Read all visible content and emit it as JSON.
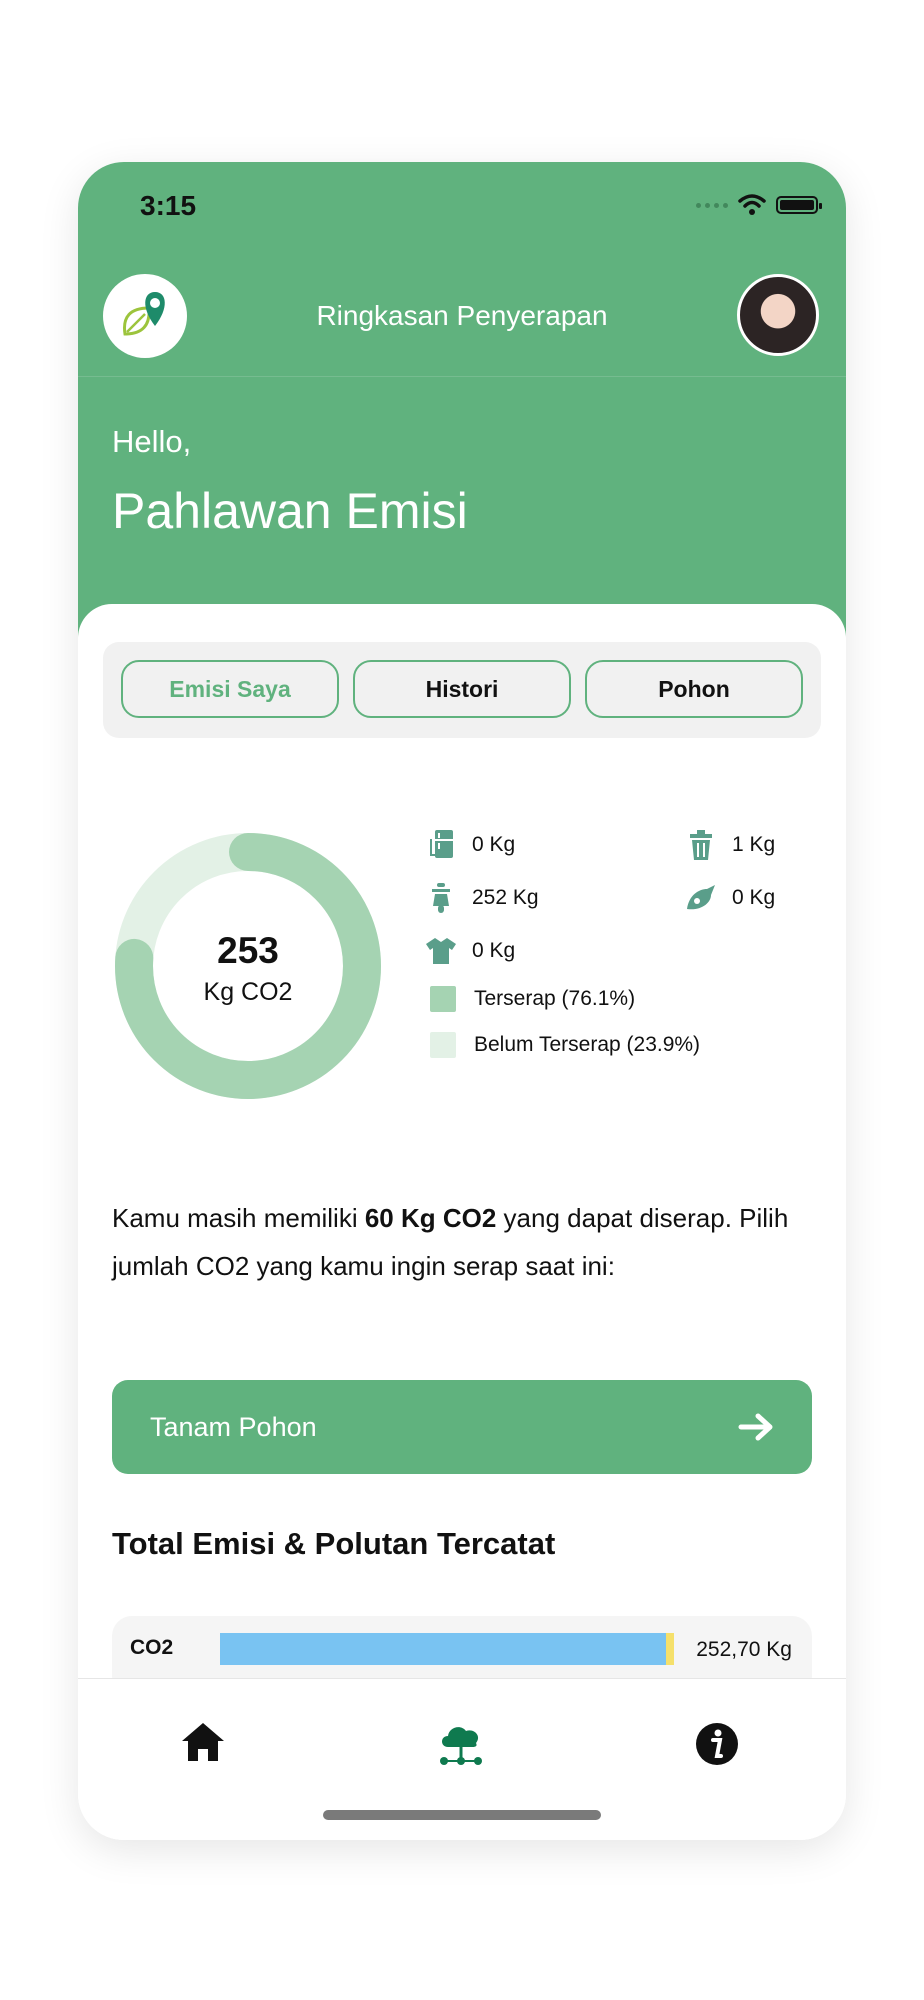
{
  "status": {
    "time": "3:15"
  },
  "header": {
    "title": "Ringkasan Penyerapan",
    "greeting": "Hello,",
    "name": "Pahlawan Emisi"
  },
  "tabs": [
    "Emisi Saya",
    "Histori",
    "Pohon"
  ],
  "summary": {
    "total_value": "253",
    "total_unit": "Kg CO2",
    "absorbed_fraction": 0.761,
    "stats": [
      {
        "icon": "fridge-icon",
        "value": "0 Kg"
      },
      {
        "icon": "trash-icon",
        "value": "1 Kg"
      },
      {
        "icon": "scooter-icon",
        "value": "252 Kg"
      },
      {
        "icon": "food-icon",
        "value": "0 Kg"
      },
      {
        "icon": "shirt-icon",
        "value": "0 Kg"
      }
    ],
    "legend": [
      {
        "label": "Terserap (76.1%)",
        "color": "#a5d3b2"
      },
      {
        "label": "Belum Terserap (23.9%)",
        "color": "#e3f1e6"
      }
    ]
  },
  "message": {
    "prefix": "Kamu masih memiliki ",
    "highlight": "60 Kg CO2",
    "suffix": " yang dapat diserap. Pilih jumlah CO2 yang kamu ingin serap saat ini:"
  },
  "cta": {
    "label": "Tanam Pohon"
  },
  "emissions": {
    "title": "Total Emisi & Polutan Tercatat",
    "rows": [
      {
        "label": "CO2",
        "value": "252,70 Kg",
        "fraction": 0.98
      }
    ]
  },
  "colors": {
    "primary": "#60b27e",
    "bar": "#79c3f2",
    "bar_tail": "#f5e06b"
  },
  "nav": [
    "home-icon",
    "cloud-network-icon",
    "info-icon"
  ]
}
